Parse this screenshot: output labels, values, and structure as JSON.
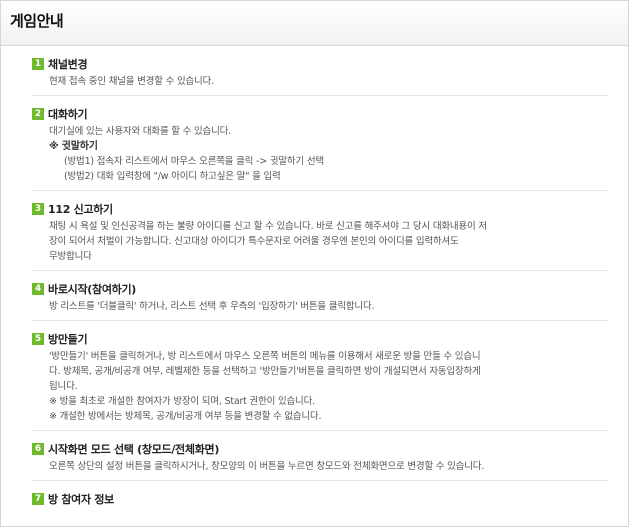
{
  "header": {
    "title": "게임안내"
  },
  "sections": [
    {
      "num": "1",
      "title": "채널변경",
      "lines": [
        "현재 접속 중인 채널을 변경할 수 있습니다."
      ]
    },
    {
      "num": "2",
      "title": "대화하기",
      "lines": [
        "대기실에 있는 사용자와 대화를 할 수 있습니다."
      ],
      "note": "※ 귓말하기",
      "sub": [
        "(방법1) 접속자 리스트에서 마우스 오른쪽을 클릭 -> 귓말하기 선택",
        "(방법2) 대화 입력창에 \"/w 아이디 하고싶은 말\" 을 입력"
      ]
    },
    {
      "num": "3",
      "title": "112 신고하기",
      "lines": [
        "채팅 시 욕설 및 인신공격을 하는 불량 아이디를 신고 할 수 있습니다. 바로 신고를 해주셔야 그 당시 대화내용이 저",
        "장이 되어서 처벌이 가능합니다. 신고대상 아이디가 특수문자로 어려울 경우엔 본인의 아이디를 입력하셔도",
        "무방합니다"
      ]
    },
    {
      "num": "4",
      "title": "바로시작(참여하기)",
      "lines": [
        "방 리스트를 '더블클릭' 하거나, 리스트 선택 후 우측의 '입장하기' 버튼을 클릭합니다."
      ]
    },
    {
      "num": "5",
      "title": "방만들기",
      "lines": [
        "'방만들기' 버튼을 클릭하거나, 방 리스트에서 마우스 오른쪽 버튼의 메뉴를 이용해서 새로운 방을 만들 수 있습니",
        "다. 방제목, 공개/비공개 여부, 레벨제한 등을 선택하고 '방만들기'버튼을 클릭하면 방이 개설되면서 자동입장하게",
        "됩니다.",
        "※ 방을 최초로 개설한 참여자가 방장이 되며, Start 권한이 있습니다.",
        "※ 개설한 방에서는 방제목, 공개/비공개 여부 등을 변경할 수 없습니다."
      ]
    },
    {
      "num": "6",
      "title": "시작화면 모드 선택 (창모드/전체화면)",
      "lines": [
        "오른쪽 상단의 설정 버튼을 클릭하시거나, 창모양의 이 버튼을 누르면 창모드와 전체화면으로 변경할 수 있습니다."
      ]
    },
    {
      "num": "7",
      "title": "방 참여자 정보",
      "lines": []
    }
  ]
}
